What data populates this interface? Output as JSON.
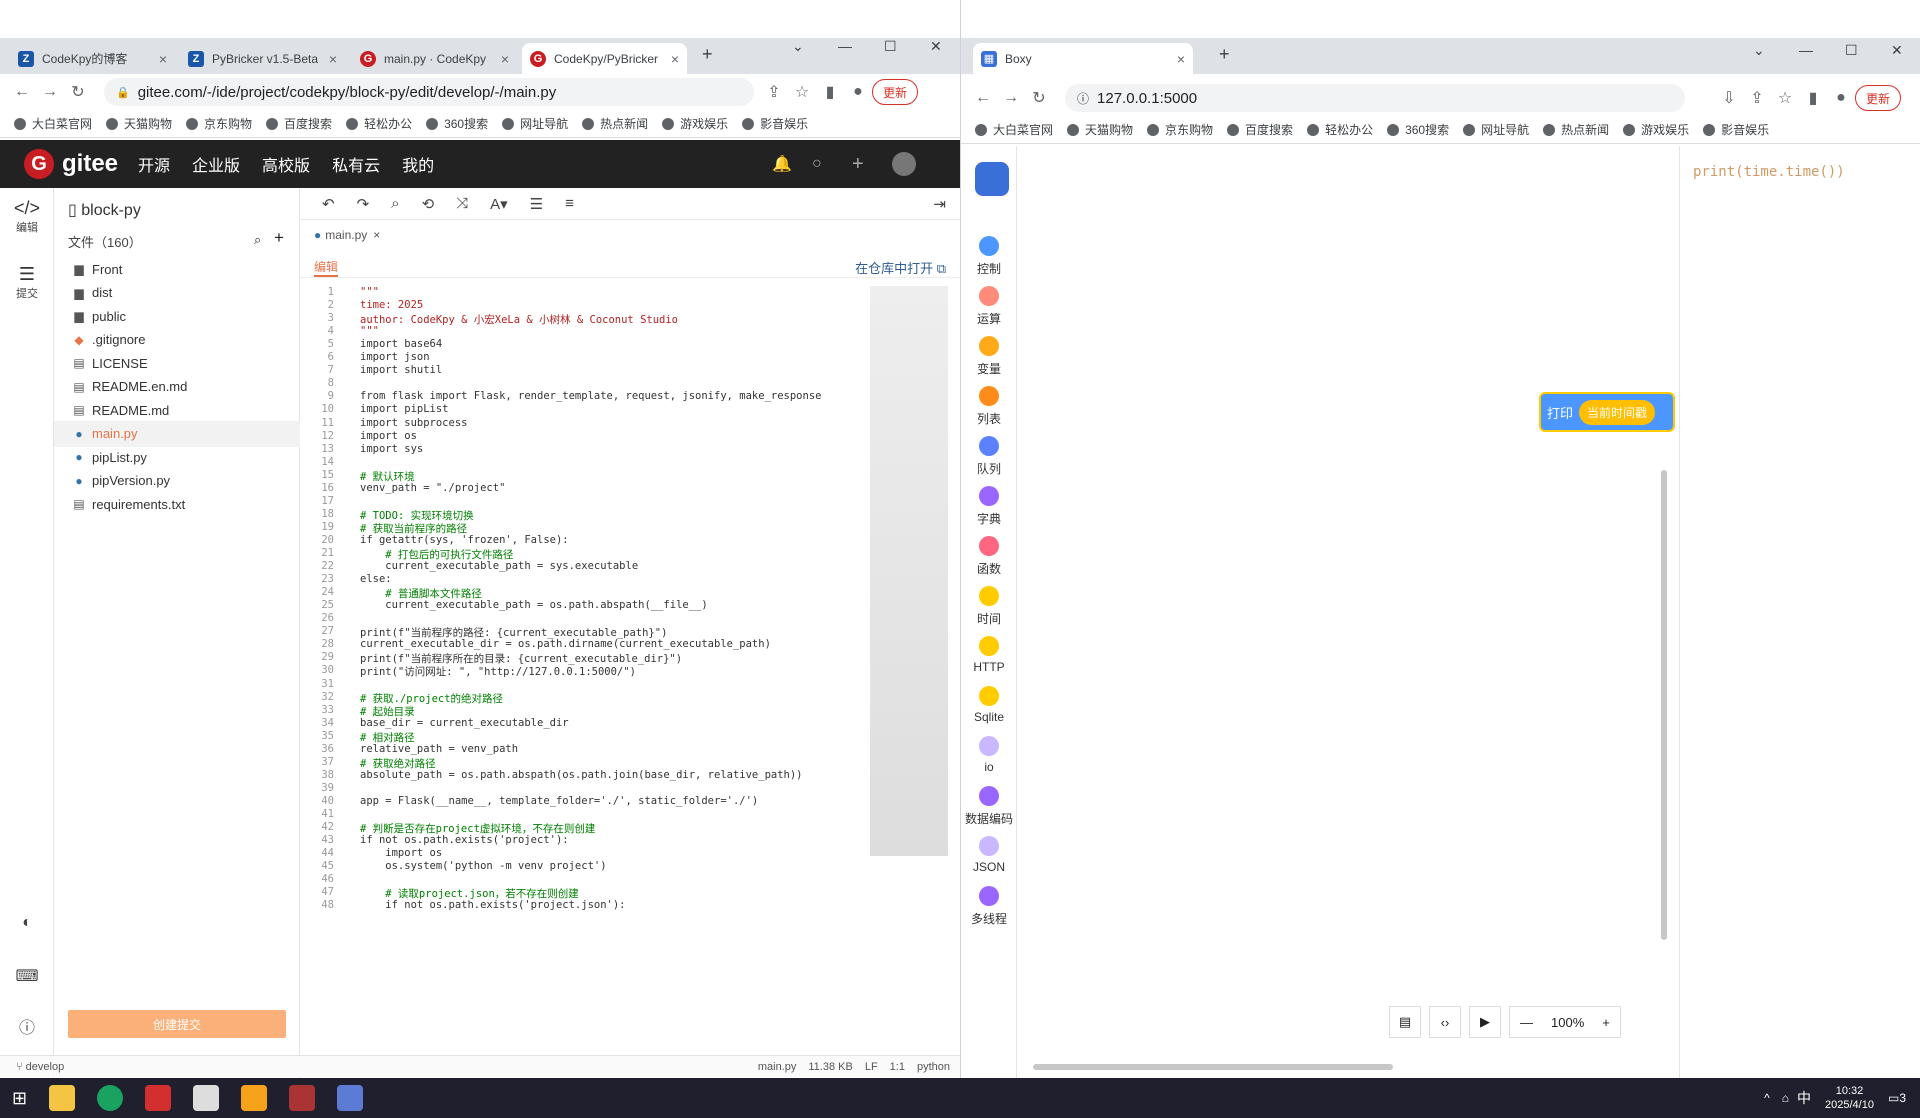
{
  "left_browser": {
    "tabs": [
      {
        "label": "CodeKpy的博客",
        "fav": "Z",
        "color": "#1a56a8"
      },
      {
        "label": "PyBricker v1.5-Beta",
        "fav": "Z",
        "color": "#1a56a8"
      },
      {
        "label": "main.py · CodeKpy",
        "fav": "G",
        "color": "#c71d23"
      },
      {
        "label": "CodeKpy/PyBricker",
        "fav": "G",
        "color": "#c71d23"
      }
    ],
    "url": "gitee.com/-/ide/project/codekpy/block-py/edit/develop/-/main.py",
    "update_label": "更新",
    "bookmarks": [
      "大白菜官网",
      "天猫购物",
      "京东购物",
      "百度搜索",
      "轻松办公",
      "360搜索",
      "网址导航",
      "热点新闻",
      "游戏娱乐",
      "影音娱乐"
    ]
  },
  "gitee": {
    "brand": "gitee",
    "nav": [
      "开源",
      "企业版",
      "高校版",
      "私有云",
      "我的"
    ],
    "rail": [
      {
        "icon": "</>",
        "label": "编辑"
      },
      {
        "icon": "☰",
        "label": "提交"
      }
    ],
    "project": "block-py",
    "files_label": "文件（160）",
    "files": [
      {
        "name": "Front",
        "icon": "▆"
      },
      {
        "name": "dist",
        "icon": "▆"
      },
      {
        "name": "public",
        "icon": "▆"
      },
      {
        "name": ".gitignore",
        "icon": "◆"
      },
      {
        "name": "LICENSE",
        "icon": "▤"
      },
      {
        "name": "README.en.md",
        "icon": "▤"
      },
      {
        "name": "README.md",
        "icon": "▤"
      },
      {
        "name": "main.py",
        "icon": "●"
      },
      {
        "name": "pipList.py",
        "icon": "●"
      },
      {
        "name": "pipVersion.py",
        "icon": "●"
      },
      {
        "name": "requirements.txt",
        "icon": "▤"
      }
    ],
    "commit_button": "创建提交",
    "branch": "develop",
    "editor_tab": "main.py",
    "edit_label": "编辑",
    "open_in_repo": "在仓库中打开",
    "status": {
      "file": "main.py",
      "size": "11.38 KB",
      "eol": "LF",
      "pos": "1:1",
      "lang": "python"
    },
    "code": [
      "\"\"\"",
      "time: 2025",
      "author: CodeKpy & 小宏XeLa & 小树林 & Coconut Studio",
      "\"\"\"",
      "import base64",
      "import json",
      "import shutil",
      "",
      "from flask import Flask, render_template, request, jsonify, make_response",
      "import pipList",
      "import subprocess",
      "import os",
      "import sys",
      "",
      "# 默认环境",
      "venv_path = \"./project\"",
      "",
      "# TODO: 实现环境切换",
      "# 获取当前程序的路径",
      "if getattr(sys, 'frozen', False):",
      "    # 打包后的可执行文件路径",
      "    current_executable_path = sys.executable",
      "else:",
      "    # 普通脚本文件路径",
      "    current_executable_path = os.path.abspath(__file__)",
      "",
      "print(f\"当前程序的路径: {current_executable_path}\")",
      "current_executable_dir = os.path.dirname(current_executable_path)",
      "print(f\"当前程序所在的目录: {current_executable_dir}\")",
      "print(\"访问网址: \", \"http://127.0.0.1:5000/\")",
      "",
      "# 获取./project的绝对路径",
      "# 起始目录",
      "base_dir = current_executable_dir",
      "# 相对路径",
      "relative_path = venv_path",
      "# 获取绝对路径",
      "absolute_path = os.path.abspath(os.path.join(base_dir, relative_path))",
      "",
      "app = Flask(__name__, template_folder='./', static_folder='./')",
      "",
      "# 判断是否存在project虚拟环境，不存在则创建",
      "if not os.path.exists('project'):",
      "    import os",
      "    os.system('python -m venv project')",
      "",
      "    # 读取project.json，若不存在则创建",
      "    if not os.path.exists('project.json'):"
    ]
  },
  "right_browser": {
    "tab": "Boxy",
    "url": "127.0.0.1:5000",
    "update_label": "更新",
    "bookmarks": [
      "大白菜官网",
      "天猫购物",
      "京东购物",
      "百度搜索",
      "轻松办公",
      "360搜索",
      "网址导航",
      "热点新闻",
      "游戏娱乐",
      "影音娱乐"
    ]
  },
  "boxy": {
    "categories": [
      {
        "label": "控制",
        "color": "#4c97ff"
      },
      {
        "label": "运算",
        "color": "#ff8c7a"
      },
      {
        "label": "变量",
        "color": "#ffab19"
      },
      {
        "label": "列表",
        "color": "#ff8c1a"
      },
      {
        "label": "队列",
        "color": "#5c81ff"
      },
      {
        "label": "字典",
        "color": "#9966ff"
      },
      {
        "label": "函数",
        "color": "#ff6680"
      },
      {
        "label": "时间",
        "color": "#ffcc00"
      },
      {
        "label": "HTTP",
        "color": "#ffcc00"
      },
      {
        "label": "Sqlite",
        "color": "#ffcc00"
      },
      {
        "label": "io",
        "color": "#c9b8ff"
      },
      {
        "label": "数据编码",
        "color": "#9966ff"
      },
      {
        "label": "JSON",
        "color": "#c9b8ff"
      },
      {
        "label": "多线程",
        "color": "#9966ff"
      }
    ],
    "block_print": "打印",
    "block_time": "当前时间戳",
    "code_preview": "print(time.time())",
    "zoom": "100%"
  },
  "taskbar": {
    "time": "10:32",
    "date": "2025/4/10",
    "ime": "中",
    "notif": "3"
  }
}
